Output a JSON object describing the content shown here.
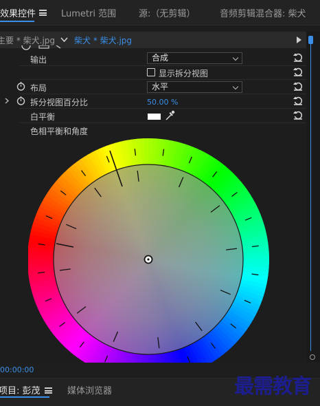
{
  "tabs": [
    {
      "label": "效果控件",
      "active": true
    },
    {
      "label": "Lumetri 范围",
      "active": false
    },
    {
      "label": "源:（无剪辑）",
      "active": false
    },
    {
      "label": "音频剪辑混合器: 柴犬",
      "active": false
    }
  ],
  "subbar": {
    "master_clip": "主要 * 柴犬.jpg",
    "sequence_clip": "柴犬 * 柴犬.jpg"
  },
  "rows": {
    "output": {
      "label": "输出",
      "value": "合成"
    },
    "split_view": {
      "label": "显示拆分视图",
      "checked": false
    },
    "layout": {
      "label": "布局",
      "value": "水平"
    },
    "split_percent": {
      "label": "拆分视图百分比",
      "value": "50.00 %"
    },
    "white_balance": {
      "label": "白平衡",
      "swatch_color": "#ffffff"
    },
    "hue_balance": {
      "label": "色相平衡和角度"
    }
  },
  "timecode": "00:00:00",
  "bottom_tabs": [
    {
      "label": "项目: 彭茂",
      "active": true
    },
    {
      "label": "媒体浏览器",
      "active": false
    }
  ],
  "watermark": "最需教育",
  "colors": {
    "accent_blue": "#3b8ee6",
    "panel_bg": "#1d1d1d"
  },
  "icons": [
    "menu-icon",
    "reset-icon",
    "stopwatch-icon",
    "eyedropper-icon",
    "chevron-down-icon",
    "play-arrow-icon"
  ]
}
